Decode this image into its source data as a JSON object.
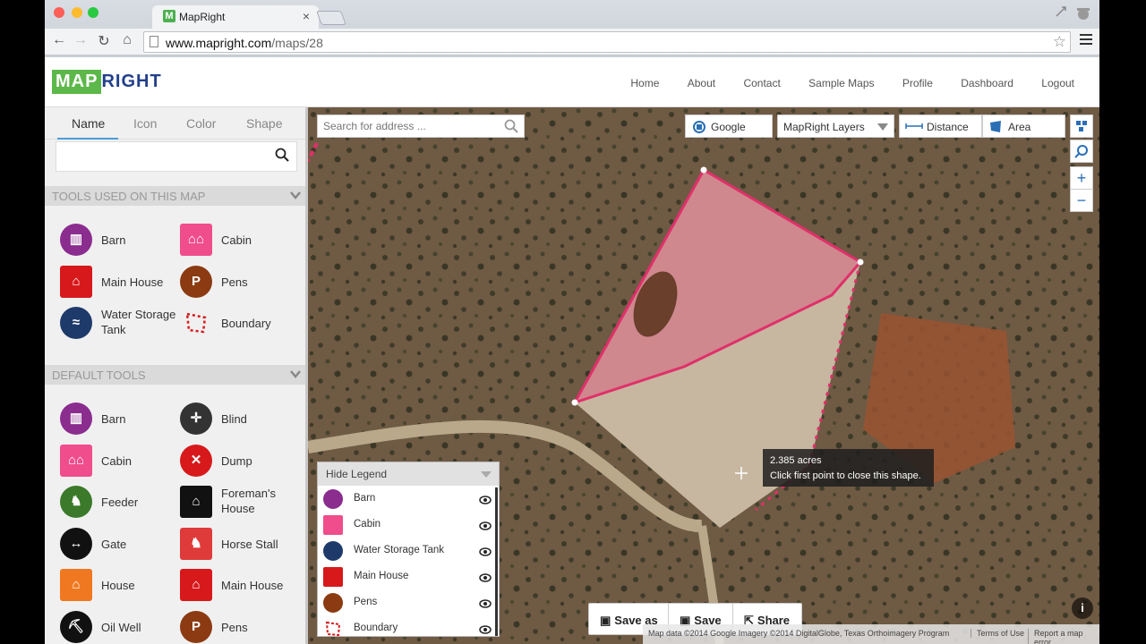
{
  "browser": {
    "tab_title": "MapRight",
    "tab_favicon_letter": "M",
    "tab_close": "×",
    "url_host": "www.mapright.com",
    "url_path": "/maps/28",
    "star": "☆"
  },
  "site": {
    "logo_map": "MAP",
    "logo_right": "RIGHT",
    "nav": [
      "Home",
      "About",
      "Contact",
      "Sample Maps",
      "Profile",
      "Dashboard",
      "Logout"
    ]
  },
  "sidebar": {
    "tabs": [
      "Name",
      "Icon",
      "Color",
      "Shape"
    ],
    "active_tab": "Name",
    "search_value": "",
    "used_section": {
      "title": "TOOLS USED ON THIS MAP",
      "tools": [
        {
          "label": "Barn",
          "icon": "barn-icon",
          "color": "#8b2c8f"
        },
        {
          "label": "Cabin",
          "icon": "cabin-icon",
          "color": "#ef4d8c"
        },
        {
          "label": "Main House",
          "icon": "main-house-icon",
          "color": "#d7191c"
        },
        {
          "label": "Pens",
          "icon": "pens-icon",
          "color": "#8b3a12"
        },
        {
          "label": "Water Storage Tank",
          "icon": "water-tank-icon",
          "color": "#1e3a6a"
        },
        {
          "label": "Boundary",
          "icon": "boundary-icon",
          "color": "#d7191c"
        }
      ]
    },
    "default_section": {
      "title": "DEFAULT TOOLS",
      "tools": [
        {
          "label": "Barn",
          "icon": "barn-icon",
          "color": "#8b2c8f"
        },
        {
          "label": "Blind",
          "icon": "blind-icon",
          "color": "#333333"
        },
        {
          "label": "Cabin",
          "icon": "cabin-icon",
          "color": "#ef4d8c"
        },
        {
          "label": "Dump",
          "icon": "dump-icon",
          "color": "#d7191c"
        },
        {
          "label": "Feeder",
          "icon": "feeder-icon",
          "color": "#3a7a2a"
        },
        {
          "label": "Foreman's House",
          "icon": "foremans-house-icon",
          "color": "#111111"
        },
        {
          "label": "Gate",
          "icon": "gate-icon",
          "color": "#111111"
        },
        {
          "label": "Horse Stall",
          "icon": "horse-stall-icon",
          "color": "#e03b3b"
        },
        {
          "label": "House",
          "icon": "house-icon",
          "color": "#f07820"
        },
        {
          "label": "Main House",
          "icon": "main-house-icon",
          "color": "#d7191c"
        },
        {
          "label": "Oil Well",
          "icon": "oil-well-icon",
          "color": "#111111"
        },
        {
          "label": "Pens",
          "icon": "pens-icon",
          "color": "#8b3a12"
        }
      ]
    }
  },
  "map": {
    "search_placeholder": "Search for address ...",
    "google_label": "Google",
    "layers_label": "MapRight Layers",
    "distance_label": "Distance",
    "area_label": "Area",
    "zoom_in": "+",
    "zoom_out": "−",
    "tooltip_area": "2.385 acres",
    "tooltip_hint": "Click first point to close this shape.",
    "legend": {
      "toggle_label": "Hide Legend",
      "items": [
        {
          "label": "Barn",
          "color": "#8b2c8f"
        },
        {
          "label": "Cabin",
          "color": "#ef4d8c"
        },
        {
          "label": "Water Storage Tank",
          "color": "#1e3a6a"
        },
        {
          "label": "Main House",
          "color": "#d7191c"
        },
        {
          "label": "Pens",
          "color": "#8b3a12"
        },
        {
          "label": "Boundary",
          "color": "#d7191c"
        }
      ]
    },
    "actions": {
      "save_as": "Save as",
      "save": "Save",
      "share": "Share"
    },
    "attribution": {
      "data": "Map data ©2014 Google Imagery ©2014 DigitalGlobe, Texas Orthoimagery Program",
      "terms": "Terms of Use",
      "report": "Report a map error"
    },
    "info": "i",
    "boundary_color": "#e0306a"
  }
}
